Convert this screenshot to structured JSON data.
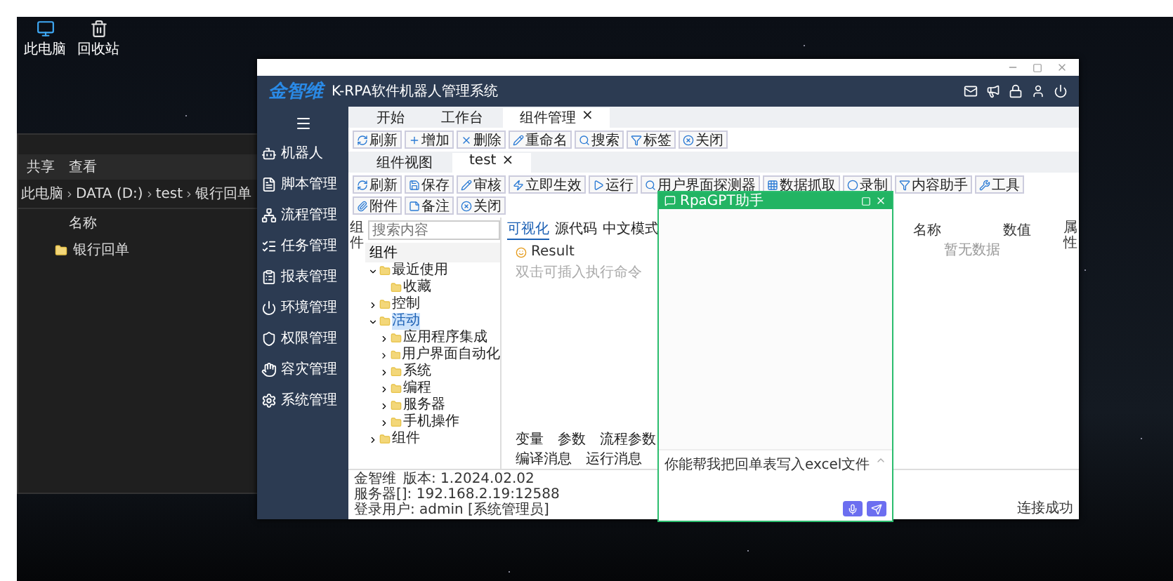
{
  "desktop": {
    "icons": [
      {
        "label": "此电脑",
        "kind": "computer"
      },
      {
        "label": "回收站",
        "kind": "recycle"
      }
    ]
  },
  "explorer": {
    "menu": [
      "共享",
      "查看"
    ],
    "breadcrumb": [
      "此电脑",
      "DATA (D:)",
      "test",
      "银行回单"
    ],
    "column": "名称",
    "files": [
      "银行回单"
    ]
  },
  "app": {
    "logo": "金智维",
    "title": "K-RPA软件机器人管理系统",
    "sidebar": [
      "机器人",
      "脚本管理",
      "流程管理",
      "任务管理",
      "报表管理",
      "环境管理",
      "权限管理",
      "容灾管理",
      "系统管理"
    ],
    "tabs": [
      {
        "label": "开始",
        "selected": false
      },
      {
        "label": "工作台",
        "selected": false
      },
      {
        "label": "组件管理",
        "selected": true,
        "close": "×"
      }
    ],
    "toolbar": [
      "刷新",
      "增加",
      "删除",
      "重命名",
      "搜索",
      "标签",
      "关闭"
    ],
    "sub_tabs": [
      {
        "label": "组件视图",
        "selected": false
      },
      {
        "label": "test",
        "selected": true,
        "close": "×"
      }
    ],
    "editor_toolbar": [
      "刷新",
      "保存",
      "审核",
      "立即生效",
      "运行",
      "用户界面探测器",
      "数据抓取",
      "录制",
      "内容助手",
      "工具",
      "附件",
      "备注",
      "关闭"
    ],
    "tree": {
      "side_label": "组件",
      "search_placeholder": "搜索内容",
      "header": "组件",
      "items": [
        {
          "label": "最近使用",
          "expanded": true,
          "selected": false,
          "children": [
            {
              "label": "收藏",
              "selected": false
            }
          ]
        },
        {
          "label": "控制",
          "expanded": false,
          "selected": false
        },
        {
          "label": "活动",
          "expanded": true,
          "selected": true,
          "children": [
            {
              "label": "应用程序集成",
              "expanded": false,
              "selected": false
            },
            {
              "label": "用户界面自动化",
              "expanded": false,
              "selected": false
            },
            {
              "label": "系统",
              "expanded": false,
              "selected": false
            },
            {
              "label": "编程",
              "expanded": false,
              "selected": false
            },
            {
              "label": "服务器",
              "expanded": false,
              "selected": false
            },
            {
              "label": "手机操作",
              "expanded": false,
              "selected": false
            }
          ]
        },
        {
          "label": "组件",
          "expanded": false,
          "selected": false
        }
      ]
    },
    "editor": {
      "tabs": [
        {
          "label": "可视化",
          "selected": true
        },
        {
          "label": "源代码",
          "selected": false
        },
        {
          "label": "中文模式",
          "selected": false
        }
      ],
      "result": "Result",
      "hint": "双击可插入执行命令",
      "bottom_tabs": [
        {
          "label": "变量",
          "selected": false
        },
        {
          "label": "参数",
          "selected": false
        },
        {
          "label": "流程参数",
          "selected": false
        }
      ],
      "message_tabs": [
        {
          "label": "编译消息",
          "selected": false
        },
        {
          "label": "运行消息",
          "selected": false
        }
      ]
    },
    "properties": {
      "side_label": "属性",
      "columns": [
        "名称",
        "数值"
      ],
      "empty": "暂无数据"
    },
    "status": {
      "items": [
        "金智维",
        "版本: 1.2024.02.02",
        "服务器[]: 192.168.2.19:12588",
        "登录用户: admin [系统管理员]"
      ],
      "connection": "连接成功"
    }
  },
  "assistant": {
    "title": "RpaGPT助手",
    "input": "你能帮我把回单表写入excel文件"
  }
}
